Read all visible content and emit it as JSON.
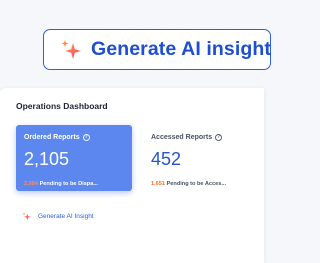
{
  "generate_button": {
    "label": "Generate AI insight",
    "icon": "sparkle-icon"
  },
  "dashboard": {
    "title": "Operations Dashboard",
    "cards": [
      {
        "title": "Ordered Reports",
        "value": "2,105",
        "pending_count": "2,084",
        "pending_text": "Pending to be Dispa..."
      },
      {
        "title": "Accessed Reports",
        "value": "452",
        "pending_count": "1,651",
        "pending_text": "Pending to be Acces..."
      }
    ],
    "insight_link": {
      "label": "Generate AI Insight",
      "icon": "sparkle-icon"
    }
  },
  "colors": {
    "accent": "#2f5fd8",
    "card_primary_bg": "#5b87ef",
    "pending_orange": "#f2702e",
    "sparkle_orange": "#ff6a3d",
    "sparkle_pink": "#ff4f7a"
  }
}
